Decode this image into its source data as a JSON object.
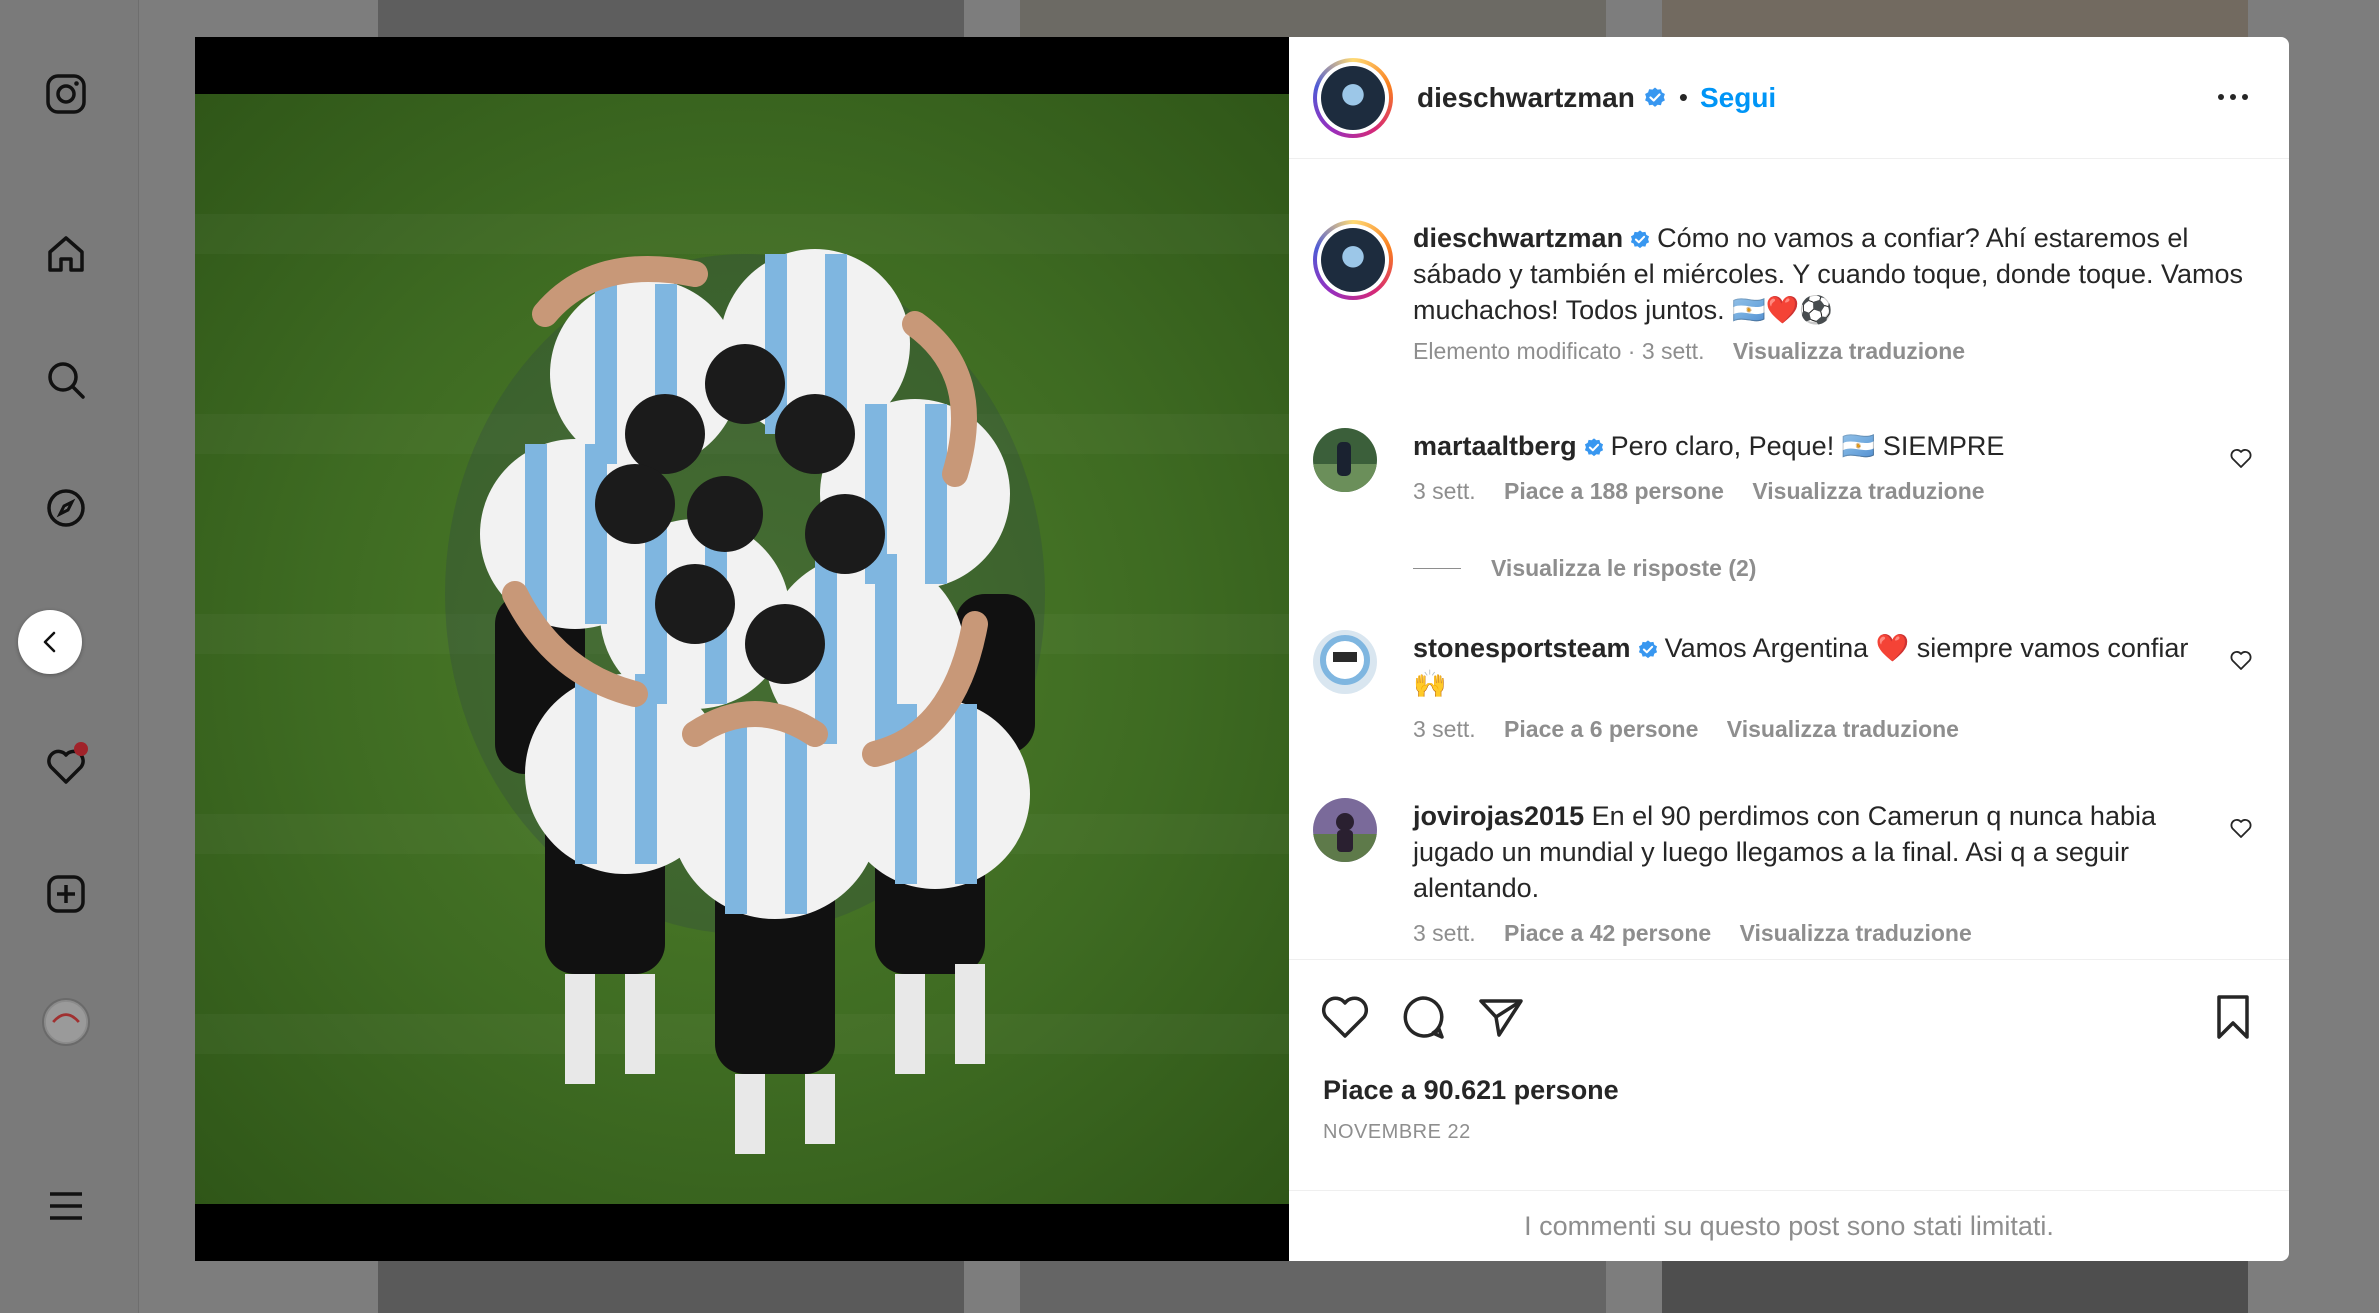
{
  "post": {
    "username": "dieschwartzman",
    "follow_label": "Segui",
    "dot": "•",
    "caption": {
      "username": "dieschwartzman",
      "text": "Cómo no vamos a confiar? Ahí estaremos el sábado y también el miércoles. Y cuando toque, donde toque. Vamos muchachos! Todos juntos. 🇦🇷❤️⚽",
      "meta_edit": "Elemento modificato · 3 sett.",
      "meta_translate": "Visualizza traduzione"
    },
    "comments": [
      {
        "username": "martaaltberg",
        "text": "Pero claro, Peque! 🇦🇷 SIEMPRE",
        "time": "3 sett.",
        "likes": "Piace a 188 persone",
        "translate": "Visualizza traduzione"
      },
      {
        "username": "stonesportsteam",
        "text": "Vamos Argentina ❤️ siempre vamos confiar 🙌",
        "time": "3 sett.",
        "likes": "Piace a 6 persone",
        "translate": "Visualizza traduzione"
      },
      {
        "username": "jovirojas2015",
        "text": "En el 90 perdimos con Camerun q nunca habia jugado un mundial y luego llegamos a la final. Asi q a seguir alentando.",
        "time": "3 sett.",
        "likes": "Piace a 42 persone",
        "translate": "Visualizza traduzione"
      }
    ],
    "replies_label": "Visualizza le risposte (2)",
    "likes_count": "Piace a 90.621 persone",
    "date": "NOVEMBRE 22",
    "comments_limited": "I commenti su questo post sono stati limitati."
  },
  "icons": {
    "sidebar": [
      "instagram-icon",
      "home-icon",
      "search-icon",
      "explore-icon",
      "reels-icon",
      "notifications-icon",
      "create-icon",
      "profile-avatar",
      "menu-icon"
    ],
    "actions": [
      "heart-icon",
      "comment-icon",
      "share-icon",
      "bookmark-icon"
    ]
  },
  "colors": {
    "accent": "#0095f6",
    "verified": "#3897f0",
    "notification": "#a0232a"
  }
}
